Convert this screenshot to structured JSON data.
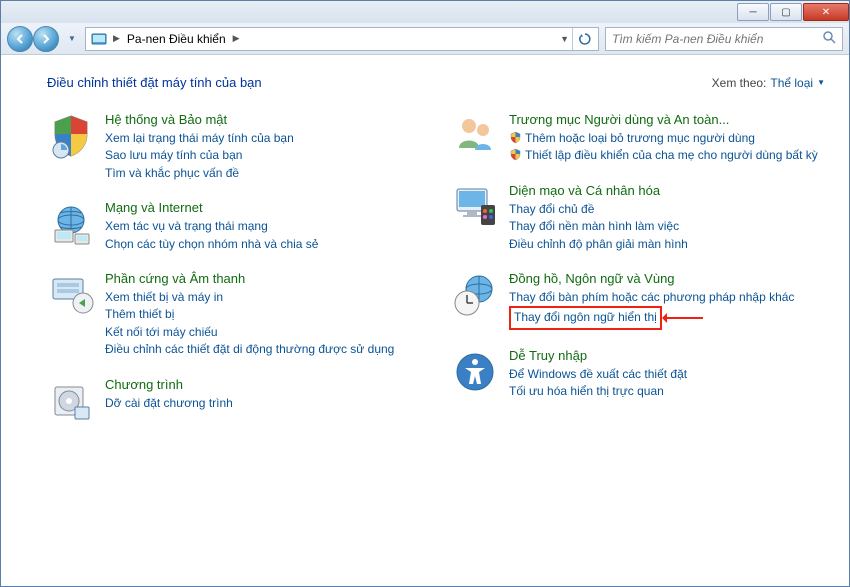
{
  "addressbar": {
    "segment": "Pa-nen Điều khiển"
  },
  "search": {
    "placeholder": "Tìm kiếm Pa-nen Điều khiển"
  },
  "heading": "Điều chỉnh thiết đặt máy tính của bạn",
  "viewby": {
    "label": "Xem theo:",
    "value": "Thể loại"
  },
  "left": [
    {
      "title": "Hệ thống và Bảo mật",
      "tasks": [
        "Xem lại trạng thái máy tính của bạn",
        "Sao lưu máy tính của bạn",
        "Tìm và khắc phục vấn đề"
      ]
    },
    {
      "title": "Mạng và Internet",
      "tasks": [
        "Xem tác vụ và trạng thái mạng",
        "Chọn các tùy chọn nhóm nhà và chia sẻ"
      ]
    },
    {
      "title": "Phần cứng và Âm thanh",
      "tasks": [
        "Xem thiết bị và máy in",
        "Thêm thiết bị",
        "Kết nối tới máy chiếu",
        "Điều chỉnh các thiết đặt di động thường được sử dụng"
      ]
    },
    {
      "title": "Chương trình",
      "tasks": [
        "Dỡ cài đặt chương trình"
      ]
    }
  ],
  "right": [
    {
      "title": "Trương mục Người dùng và An toàn...",
      "tasks_shield": [
        "Thêm hoặc loại bỏ trương mục người dùng",
        "Thiết lập điều khiển của cha mẹ cho người dùng bất kỳ"
      ]
    },
    {
      "title": "Diện mạo và Cá nhân hóa",
      "tasks": [
        "Thay đổi chủ đề",
        "Thay đổi nền màn hình làm việc",
        "Điều chỉnh độ phân giải màn hình"
      ]
    },
    {
      "title": "Đồng hồ, Ngôn ngữ và Vùng",
      "tasks": [
        "Thay đổi bàn phím hoặc các phương pháp nhập khác"
      ],
      "highlighted_task": "Thay đổi ngôn ngữ hiển thị"
    },
    {
      "title": "Dễ Truy nhập",
      "tasks": [
        "Để Windows đề xuất các thiết đặt",
        "Tối ưu hóa hiển thị trực quan"
      ]
    }
  ]
}
